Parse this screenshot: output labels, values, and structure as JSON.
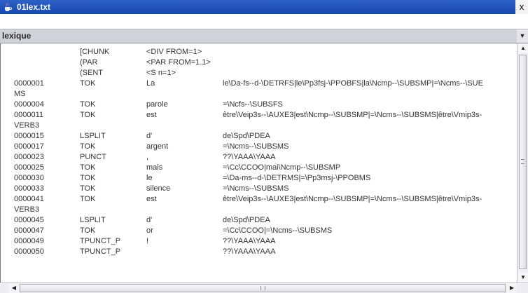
{
  "window": {
    "title": "01lex.txt",
    "close_glyph": "x",
    "app_icon": "java-cup-icon"
  },
  "combo": {
    "selected": "lexique",
    "arrow_glyph": "▼"
  },
  "scrollbars": {
    "up": "▲",
    "down": "▼",
    "left": "◀",
    "right": "▶"
  },
  "rows": [
    {
      "c1": "",
      "c2": "[CHUNK",
      "c3": "<DIV FROM=1>",
      "c4": ""
    },
    {
      "c1": "",
      "c2": "(PAR",
      "c3": "<PAR FROM=1.1>",
      "c4": ""
    },
    {
      "c1": "",
      "c2": "(SENT",
      "c3": "<S n=1>",
      "c4": ""
    },
    {
      "c1": "0000001",
      "c2": "TOK",
      "c3": "La",
      "c4": "le\\Da-fs--d-\\DETRFS|le\\Pp3fsj-\\PPOBFS|la\\Ncmp--\\SUBSMP|=\\Ncms--\\SUE"
    },
    {
      "c1": "MS",
      "c2": "",
      "c3": "",
      "c4": ""
    },
    {
      "c1": "0000004",
      "c2": "TOK",
      "c3": "parole",
      "c4": "=\\Ncfs--\\SUBSFS"
    },
    {
      "c1": "0000011",
      "c2": "TOK",
      "c3": "est",
      "c4": "être\\Veip3s--\\AUXE3|est\\Ncmp--\\SUBSMP|=\\Ncms--\\SUBSMS|être\\Vmip3s-"
    },
    {
      "c1": "VERB3",
      "c2": "",
      "c3": "",
      "c4": ""
    },
    {
      "c1": "0000015",
      "c2": "LSPLIT",
      "c3": "d'",
      "c4": "de\\Spd\\PDEA"
    },
    {
      "c1": "0000017",
      "c2": "TOK",
      "c3": "argent",
      "c4": "=\\Ncms--\\SUBSMS"
    },
    {
      "c1": "0000023",
      "c2": "PUNCT",
      "c3": ",",
      "c4": "??\\YAAA\\YAAA"
    },
    {
      "c1": "0000025",
      "c2": "TOK",
      "c3": "mais",
      "c4": "=\\Cc\\CCOO|mai\\Ncmp--\\SUBSMP"
    },
    {
      "c1": "0000030",
      "c2": "TOK",
      "c3": "le",
      "c4": "=\\Da-ms--d-\\DETRMS|=\\Pp3msj-\\PPOBMS"
    },
    {
      "c1": "0000033",
      "c2": "TOK",
      "c3": "silence",
      "c4": "=\\Ncms--\\SUBSMS"
    },
    {
      "c1": "0000041",
      "c2": "TOK",
      "c3": "est",
      "c4": "être\\Veip3s--\\AUXE3|est\\Ncmp--\\SUBSMP|=\\Ncms--\\SUBSMS|être\\Vmip3s-"
    },
    {
      "c1": "VERB3",
      "c2": "",
      "c3": "",
      "c4": ""
    },
    {
      "c1": "0000045",
      "c2": "LSPLIT",
      "c3": "d'",
      "c4": "de\\Spd\\PDEA"
    },
    {
      "c1": "0000047",
      "c2": "TOK",
      "c3": "or",
      "c4": "=\\Cc\\CCOO|=\\Ncms--\\SUBSMS"
    },
    {
      "c1": "0000049",
      "c2": "TPUNCT_P",
      "c3": "!",
      "c4": "??\\YAAA\\YAAA"
    },
    {
      "c1": "0000050",
      "c2": "TPUNCT_P",
      "c3": "",
      "c4": "??\\YAAA\\YAAA"
    }
  ]
}
